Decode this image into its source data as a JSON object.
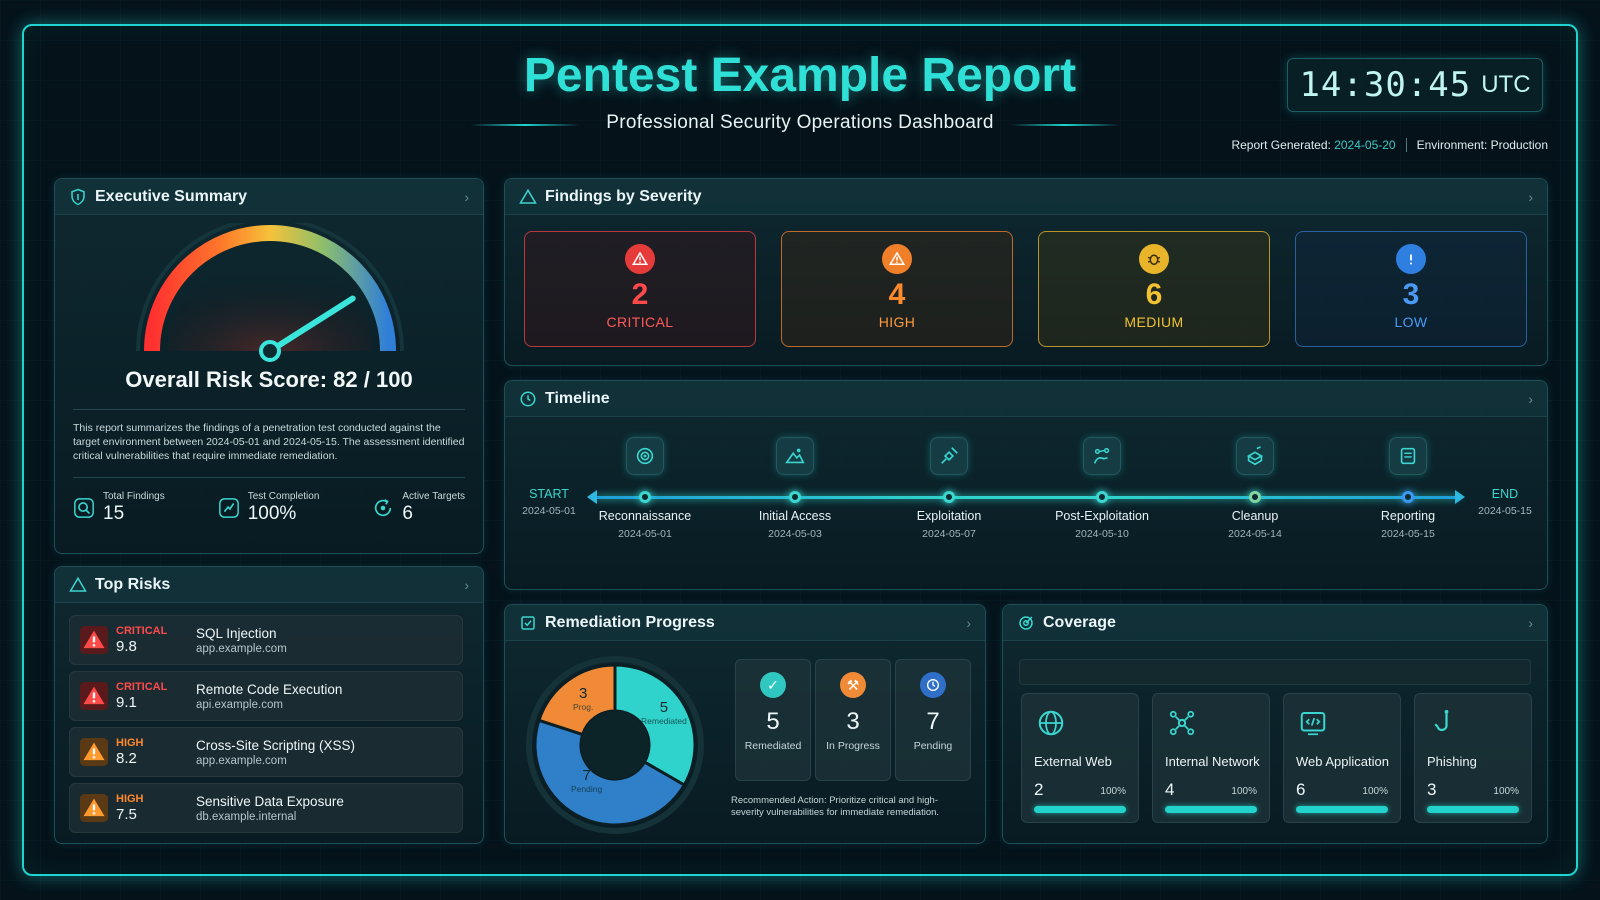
{
  "header": {
    "title": "Pentest Example Report",
    "subtitle": "Professional Security Operations Dashboard",
    "clock_time": "14:30:45",
    "clock_tz": "UTC",
    "report_generated_label": "Report Generated:",
    "report_generated_date": "2024-05-20",
    "environment": "Environment: Production"
  },
  "executive_summary": {
    "title": "Executive Summary",
    "risk_score_text": "Overall Risk Score: 82 / 100",
    "risk_score": 82,
    "risk_max": 100,
    "description": "This report summarizes the findings of a penetration test conducted against the target environment between 2024-05-01 and 2024-05-15. The assessment identified critical vulnerabilities that require immediate remediation.",
    "stats": [
      {
        "label": "Total Findings",
        "value": "15",
        "icon": "search-icon"
      },
      {
        "label": "Test Completion",
        "value": "100%",
        "icon": "progress-icon"
      },
      {
        "label": "Active Targets",
        "value": "6",
        "icon": "target-refresh-icon"
      }
    ]
  },
  "severity": {
    "title": "Findings by Severity",
    "cards": [
      {
        "count": "2",
        "label": "CRITICAL",
        "color": "#ff4a4a",
        "icon": "warning-icon"
      },
      {
        "count": "4",
        "label": "HIGH",
        "color": "#ff8a2e",
        "icon": "warning-icon"
      },
      {
        "count": "6",
        "label": "MEDIUM",
        "color": "#f3c233",
        "icon": "bug-icon"
      },
      {
        "count": "3",
        "label": "LOW",
        "color": "#3a8ef0",
        "icon": "info-icon"
      }
    ]
  },
  "timeline": {
    "title": "Timeline",
    "start_label": "START",
    "start_date": "2024-05-01",
    "end_label": "END",
    "end_date": "2024-05-15",
    "phases": [
      {
        "name": "Reconnaissance",
        "date": "2024-05-01",
        "icon": "radar-icon"
      },
      {
        "name": "Initial Access",
        "date": "2024-05-03",
        "icon": "mountain-icon"
      },
      {
        "name": "Exploitation",
        "date": "2024-05-07",
        "icon": "satellite-icon"
      },
      {
        "name": "Post-Exploitation",
        "date": "2024-05-10",
        "icon": "network-hand-icon"
      },
      {
        "name": "Cleanup",
        "date": "2024-05-14",
        "icon": "cleanup-icon"
      },
      {
        "name": "Reporting",
        "date": "2024-05-15",
        "icon": "report-icon"
      }
    ]
  },
  "top_risks": {
    "title": "Top Risks",
    "items": [
      {
        "severity": "CRITICAL",
        "score": "9.8",
        "name": "SQL Injection",
        "host": "app.example.com",
        "color": "#ff4a4a"
      },
      {
        "severity": "CRITICAL",
        "score": "9.1",
        "name": "Remote Code Execution",
        "host": "api.example.com",
        "color": "#ff4a4a"
      },
      {
        "severity": "HIGH",
        "score": "8.2",
        "name": "Cross-Site Scripting (XSS)",
        "host": "app.example.com",
        "color": "#ff8a2e"
      },
      {
        "severity": "HIGH",
        "score": "7.5",
        "name": "Sensitive Data Exposure",
        "host": "db.example.internal",
        "color": "#ff8a2e"
      }
    ]
  },
  "remediation": {
    "title": "Remediation Progress",
    "donut": [
      {
        "value": 5,
        "label": "Remediated",
        "color": "#2fd3cb"
      },
      {
        "value": 7,
        "label": "Pending",
        "color": "#2f7fc9"
      },
      {
        "value": 3,
        "label": "Prog.",
        "color": "#f08a36"
      }
    ],
    "cards": [
      {
        "value": "5",
        "label": "Remediated",
        "color": "#2fc7c0",
        "icon": "check-icon"
      },
      {
        "value": "3",
        "label": "In Progress",
        "color": "#f08a36",
        "icon": "wrench-icon"
      },
      {
        "value": "7",
        "label": "Pending",
        "color": "#3a8ef0",
        "icon": "clock-icon"
      }
    ],
    "action": "Recommended Action: Prioritize critical and high-severity vulnerabilities for immediate remediation."
  },
  "coverage": {
    "title": "Coverage",
    "items": [
      {
        "name": "External Web",
        "value": "2",
        "percent": "100%",
        "fill": 1.0,
        "icon": "globe-icon"
      },
      {
        "name": "Internal Network",
        "value": "4",
        "percent": "100%",
        "fill": 1.0,
        "icon": "network-icon"
      },
      {
        "name": "Web Application",
        "value": "6",
        "percent": "100%",
        "fill": 1.0,
        "icon": "code-window-icon"
      },
      {
        "name": "Phishing",
        "value": "3",
        "percent": "100%",
        "fill": 1.0,
        "icon": "hook-icon"
      }
    ]
  }
}
